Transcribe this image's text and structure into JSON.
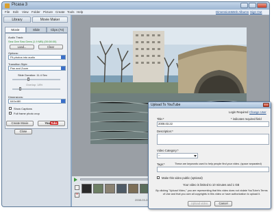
{
  "app": {
    "title": "Picasa 3",
    "menu": [
      "File",
      "Edit",
      "View",
      "Folder",
      "Picture",
      "Create",
      "Tools",
      "Help"
    ],
    "right_links": [
      "Dimensions",
      "Web Albums",
      "Sign Out"
    ]
  },
  "left_pane": {
    "tabs": [
      "Library",
      "Movie Maker"
    ],
    "subtabs": [
      "Movie",
      "Slide",
      "Clips (74)"
    ],
    "audio_track_label": "Audio Track:",
    "audio_track_value": "Sea Gee Sea Gees (1.9 MB) (00:08:00)",
    "load_label": "Load...",
    "clear_label": "Clear",
    "options_label": "Options:",
    "options_value": "Fit photos into audio",
    "transition_label": "Transition Style:",
    "transition_value": "Pan and Zoom",
    "slide_duration_label": "Slide Duration: 11.4 Sec",
    "overlap_label": "Overlap: 18%",
    "dimensions_label": "Dimensions:",
    "dimensions_value": "640x480",
    "show_captions_label": "Show Captions",
    "full_frame_label": "Full frame photo crop",
    "create_movie_label": "Create Movie",
    "youtube_label": "You",
    "youtube_tube": "Tube",
    "close_label": "Close"
  },
  "timeline": {
    "timestamp": "2008-03-22"
  },
  "dialog": {
    "title": "Upload To YouTube",
    "login_required": "Login Required",
    "change_user": "Change User",
    "title_label": "Title:*",
    "required_note": "* indicates required field",
    "title_value": "2008.03.22",
    "description_label": "Description:*",
    "category_label": "Video Category:*",
    "category_value": "--",
    "tags_label": "Tags:*",
    "tags_note": "These are keywords used to help people find your video. (space separated)",
    "public_label": "Make this video public (optional)",
    "limit_note": "Your video is limited to 10 minutes and 1 GB",
    "terms_note": "By clicking \"Upload Video,\" you are representing that this video does not violate YouTube's Terms of Use and that you own all copyrights in this video or have authorization to upload it.",
    "upload_label": "Upload video",
    "cancel_label": "Cancel"
  },
  "colors": {
    "accent_blue": "#3a6fc9",
    "audio_green": "#2e8b2e",
    "youtube_red": "#cc1f1f"
  }
}
